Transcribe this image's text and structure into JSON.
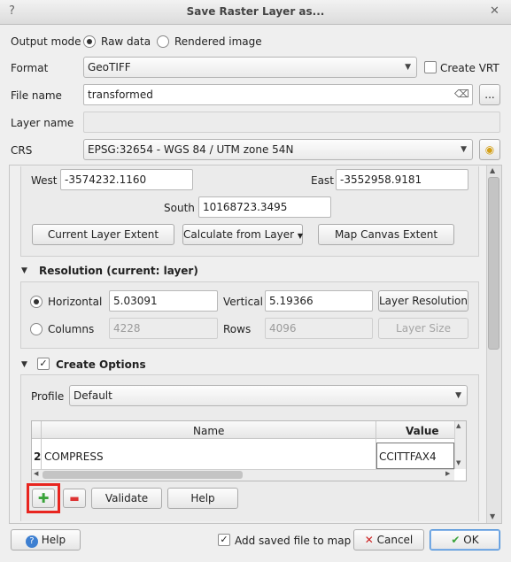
{
  "dialog": {
    "title": "Save Raster Layer as...",
    "help_icon": "question-icon",
    "close_icon": "close-icon"
  },
  "output_mode": {
    "label": "Output mode",
    "options": [
      "Raw data",
      "Rendered image"
    ],
    "selected": "Raw data"
  },
  "format": {
    "label": "Format",
    "value": "GeoTIFF",
    "create_vrt_label": "Create VRT",
    "create_vrt_checked": false
  },
  "file_name": {
    "label": "File name",
    "value": "transformed",
    "browse_label": "..."
  },
  "layer_name": {
    "label": "Layer name",
    "value": ""
  },
  "crs": {
    "label": "CRS",
    "value": "EPSG:32654 - WGS 84 / UTM zone 54N"
  },
  "extent": {
    "west_label": "West",
    "west": "-3574232.1160",
    "east_label": "East",
    "east": "-3552958.9181",
    "south_label": "South",
    "south": "10168723.3495",
    "current_layer_btn": "Current Layer Extent",
    "calc_from_layer_btn": "Calculate from Layer",
    "map_canvas_btn": "Map Canvas Extent"
  },
  "resolution": {
    "header": "Resolution (current: layer)",
    "horizontal_label": "Horizontal",
    "horizontal": "5.03091",
    "vertical_label": "Vertical",
    "vertical": "5.19366",
    "layer_resolution_btn": "Layer Resolution",
    "columns_label": "Columns",
    "columns": "4228",
    "rows_label": "Rows",
    "rows": "4096",
    "layer_size_btn": "Layer Size",
    "selected": "Horizontal"
  },
  "create_options": {
    "header": "Create Options",
    "checked": true,
    "profile_label": "Profile",
    "profile": "Default",
    "table": {
      "headers": [
        "Name",
        "Value"
      ],
      "rows": [
        {
          "row_num": "2",
          "name": "COMPRESS",
          "value": "CCITTFAX4"
        }
      ]
    },
    "add_icon": "plus-icon",
    "remove_icon": "minus-icon",
    "validate_btn": "Validate",
    "help_btn": "Help"
  },
  "footer": {
    "help_btn": "Help",
    "add_saved_label": "Add saved file to map",
    "add_saved_checked": true,
    "cancel_btn": "Cancel",
    "ok_btn": "OK"
  },
  "colors": {
    "highlight": "#e8251f",
    "ok_border": "#4a90d9",
    "check_green": "#3aa33a"
  }
}
